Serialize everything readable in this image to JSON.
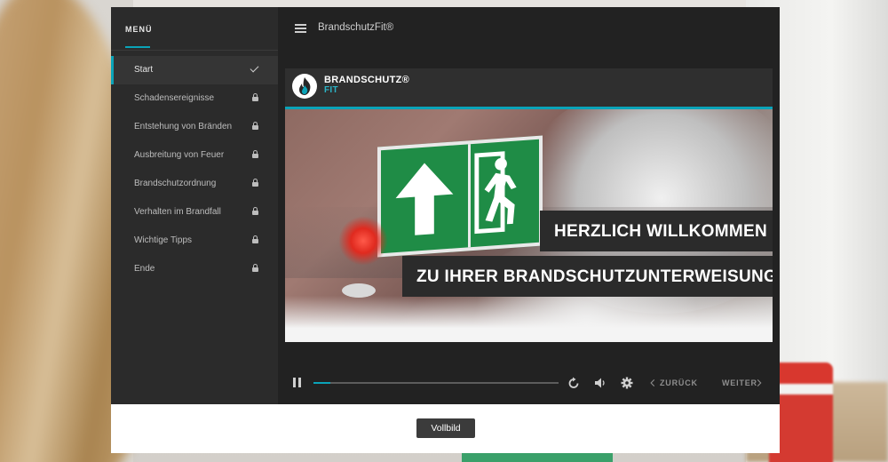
{
  "menu": {
    "title": "MENÜ",
    "items": [
      {
        "label": "Start",
        "status": "complete"
      },
      {
        "label": "Schadensereignisse",
        "status": "locked"
      },
      {
        "label": "Entstehung von Bränden",
        "status": "locked"
      },
      {
        "label": "Ausbreitung von Feuer",
        "status": "locked"
      },
      {
        "label": "Brandschutzordnung",
        "status": "locked"
      },
      {
        "label": "Verhalten im Brandfall",
        "status": "locked"
      },
      {
        "label": "Wichtige Tipps",
        "status": "locked"
      },
      {
        "label": "Ende",
        "status": "locked"
      }
    ]
  },
  "header": {
    "app_title": "BrandschutzFit®"
  },
  "slide": {
    "brand_name": "BRANDSCHUTZ®",
    "brand_sub": "FIT",
    "headline_1": "HERZLICH WILLKOMMEN",
    "headline_2": "ZU IHRER BRANDSCHUTZUNTERWEISUNG"
  },
  "player": {
    "progress_fraction": 0.07,
    "back_label": "ZURÜCK",
    "next_label": "WEITER"
  },
  "footer": {
    "fullscreen_label": "Vollbild"
  },
  "colors": {
    "accent": "#0aa3b8",
    "sidebar_bg": "#2b2b2b",
    "main_bg": "#222222",
    "exit_sign_green": "#1f8c46"
  }
}
